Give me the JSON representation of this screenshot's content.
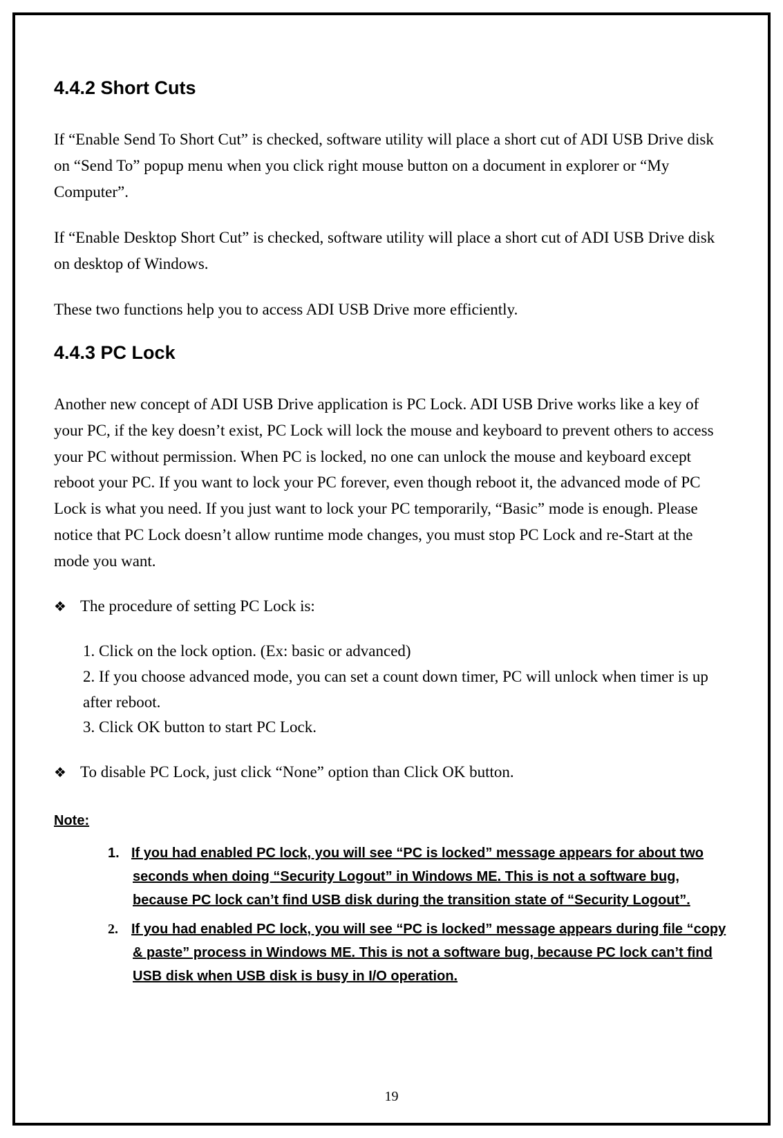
{
  "section1": {
    "heading": "4.4.2 Short Cuts",
    "p1": "If “Enable Send To Short Cut” is checked, software utility will place a short cut of ADI USB Drive disk on “Send To” popup menu when you click right mouse button on a document in explorer or “My Computer”.",
    "p2": "If “Enable Desktop Short Cut” is checked, software utility will place a short cut of ADI USB Drive disk on desktop of Windows.",
    "p3": "These two functions help you to access ADI USB Drive more efficiently."
  },
  "section2": {
    "heading": "4.4.3 PC Lock",
    "p1": "Another new concept of ADI USB Drive application is PC Lock. ADI USB Drive works like a key of your PC, if the key doesn’t exist, PC Lock will lock the mouse and keyboard to prevent others to access your PC without permission. When PC is locked, no one can unlock the mouse and keyboard except reboot your PC. If you want to lock your PC forever, even though reboot it, the advanced mode of PC Lock is what you need. If you just want to lock your PC temporarily, “Basic” mode is enough. Please notice that PC Lock doesn’t allow runtime mode changes, you must stop PC Lock and re-Start at the mode you want.",
    "bullet1": "The procedure of setting PC Lock is:",
    "steps": {
      "s1": "1. Click on the lock option. (Ex: basic or advanced)",
      "s2": "2. If you choose advanced mode, you can set a count down timer, PC will unlock when timer is up after reboot.",
      "s3": "3. Click OK button to start PC Lock."
    },
    "bullet2": "To disable PC Lock, just click “None” option than Click OK button."
  },
  "note": {
    "heading": "Note:",
    "n1": "If you had enabled PC lock, you will see “PC is locked” message appears for about two seconds when doing “Security Logout” in Windows ME. This is not a software bug, because PC lock can’t find USB disk during the transition state of “Security Logout”.",
    "n2": "If you had enabled PC lock, you will see “PC is locked” message appears during file “copy & paste” process in Windows ME. This is not a software bug, because PC lock can’t find USB disk when USB disk is busy in I/O operation."
  },
  "page_number": "19"
}
